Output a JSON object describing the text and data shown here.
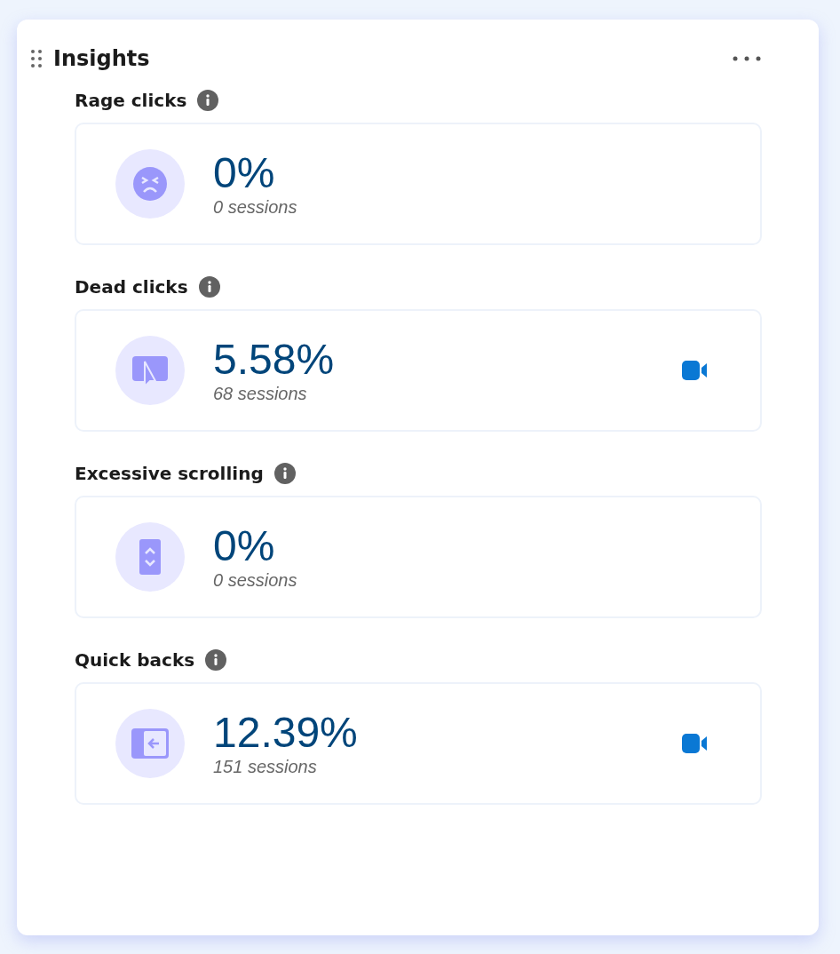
{
  "title": "Insights",
  "metrics": [
    {
      "kind": "rage",
      "label": "Rage clicks",
      "value": "0%",
      "sessions": "0 sessions",
      "recording": false
    },
    {
      "kind": "dead",
      "label": "Dead clicks",
      "value": "5.58%",
      "sessions": "68 sessions",
      "recording": true
    },
    {
      "kind": "scroll",
      "label": "Excessive scrolling",
      "value": "0%",
      "sessions": "0 sessions",
      "recording": false
    },
    {
      "kind": "back",
      "label": "Quick backs",
      "value": "12.39%",
      "sessions": "151 sessions",
      "recording": true
    }
  ]
}
